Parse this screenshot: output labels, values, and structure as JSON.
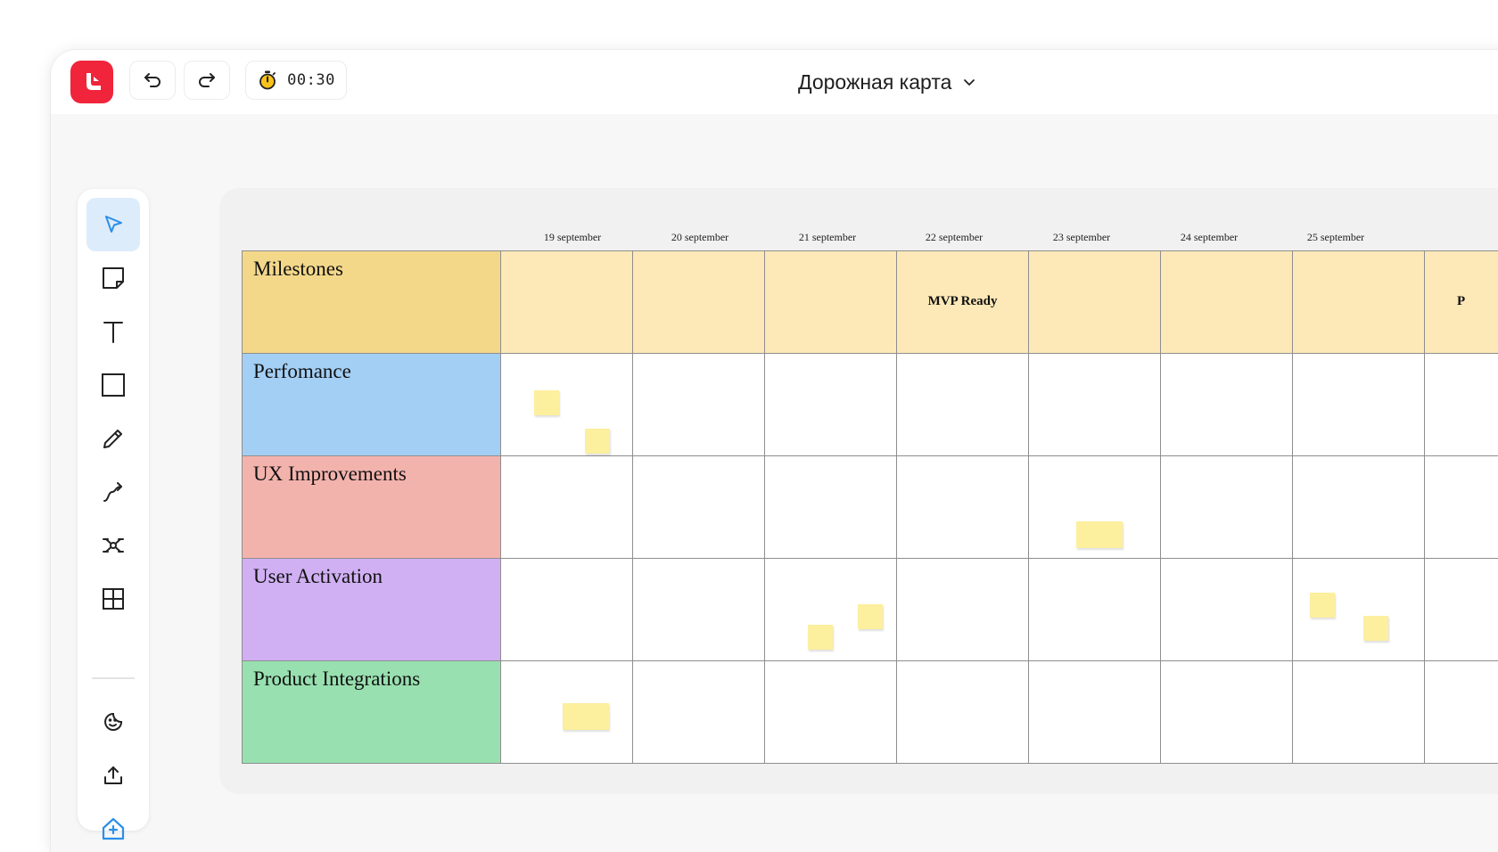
{
  "app": {
    "timer": "00:30",
    "board_title": "Дорожная карта"
  },
  "toolbar": {
    "tools": [
      {
        "name": "select-tool",
        "icon": "cursor-icon",
        "active": true
      },
      {
        "name": "sticky-note-tool",
        "icon": "sticky-note-icon",
        "active": false
      },
      {
        "name": "text-tool",
        "icon": "text-icon",
        "active": false
      },
      {
        "name": "shape-tool",
        "icon": "rectangle-icon",
        "active": false
      },
      {
        "name": "pen-tool",
        "icon": "pencil-icon",
        "active": false
      },
      {
        "name": "connector-tool",
        "icon": "connector-icon",
        "active": false
      },
      {
        "name": "mindmap-tool",
        "icon": "mindmap-icon",
        "active": false
      },
      {
        "name": "table-tool",
        "icon": "table-icon",
        "active": false
      },
      {
        "name": "sticker-tool",
        "icon": "sticker-icon",
        "active": false
      },
      {
        "name": "upload-tool",
        "icon": "upload-icon",
        "active": false
      },
      {
        "name": "add-app-tool",
        "icon": "add-app-icon",
        "active": false
      }
    ]
  },
  "roadmap": {
    "dates": [
      "19 september",
      "20 september",
      "21 september",
      "22 september",
      "23 september",
      "24 september",
      "25 september"
    ],
    "rows": [
      {
        "label": "Milestones",
        "color": "#f3d88a",
        "cell_color": "#fde8b7"
      },
      {
        "label": "Perfomance",
        "color": "#a4cff5",
        "cell_color": "#ffffff"
      },
      {
        "label": "UX Improvements",
        "color": "#f3b3ad",
        "cell_color": "#ffffff"
      },
      {
        "label": "User Activation",
        "color": "#d0b0f3",
        "cell_color": "#ffffff"
      },
      {
        "label": "Product Integrations",
        "color": "#98e0b0",
        "cell_color": "#ffffff"
      }
    ],
    "milestone": {
      "date": "22 september",
      "text": "MVP Ready"
    },
    "partial_milestone_text": "P"
  },
  "colors": {
    "brand": "#f0243a",
    "sticky": "#fcef9e",
    "active_tool_bg": "#dcecfb",
    "accent_blue": "#2b8fe8"
  }
}
